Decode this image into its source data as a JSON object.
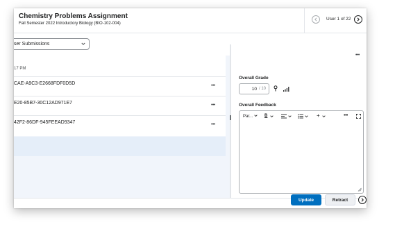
{
  "header": {
    "title": "Chemistry Problems Assignment",
    "subtitle": "Fall Semester 2022 Introductory Biology (BIO-102-004)",
    "user_count": "User 1 of 22"
  },
  "filter": {
    "selected": "ser Submissions"
  },
  "submissions": {
    "time_label": "17 PM",
    "rows": [
      {
        "id": "CAE-A9C3-E2668FDF0D5D"
      },
      {
        "id": "E20-85B7-30C12AD971E7"
      },
      {
        "id": "42F2-86DF-945FEEAD9347"
      }
    ]
  },
  "grade": {
    "label": "Overall Grade",
    "value": "10",
    "out_of": "/ 10"
  },
  "feedback": {
    "label": "Overall Feedback",
    "toolbar": {
      "paragraph": "Par...",
      "bold": "B",
      "insert": "+"
    }
  },
  "actions": {
    "update": "Update",
    "retract": "Retract"
  },
  "colors": {
    "primary": "#006fbf",
    "selected_band": "#e5eef9",
    "panel_bg": "#f1f5fb"
  }
}
